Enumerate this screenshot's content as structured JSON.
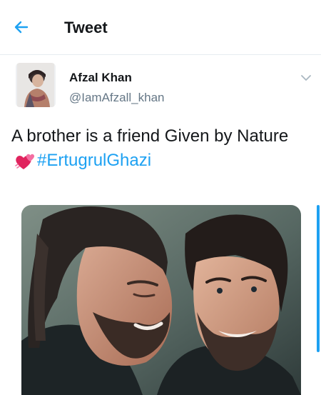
{
  "header": {
    "title": "Tweet",
    "back_icon": "arrow-left-icon",
    "accent_color": "#1da1f2"
  },
  "tweet": {
    "author": {
      "name": "Afzal Khan",
      "handle": "@IamAfzall_khan"
    },
    "text_prefix": "A brother is a friend Given by Nature",
    "emoji": "two-hearts-icon",
    "hashtag": "#ErtugrulGhazi",
    "menu_icon": "chevron-down-icon"
  }
}
